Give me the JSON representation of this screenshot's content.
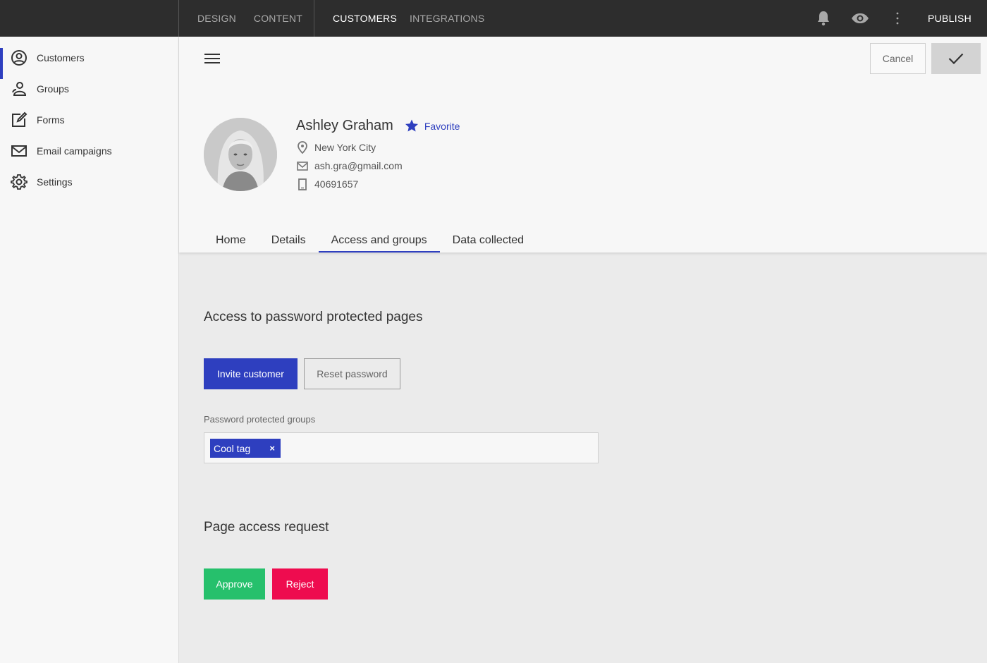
{
  "topbar": {
    "nav_left": [
      "DESIGN",
      "CONTENT"
    ],
    "nav_right": [
      "CUSTOMERS",
      "INTEGRATIONS"
    ],
    "active": "CUSTOMERS",
    "publish_label": "PUBLISH",
    "icons": [
      "bell-icon",
      "eye-icon",
      "more-vertical-icon"
    ]
  },
  "sidebar": {
    "items": [
      {
        "label": "Customers",
        "icon": "user-circle-icon",
        "active": true
      },
      {
        "label": "Groups",
        "icon": "group-icon",
        "active": false
      },
      {
        "label": "Forms",
        "icon": "edit-form-icon",
        "active": false
      },
      {
        "label": "Email campaigns",
        "icon": "mail-icon",
        "active": false
      },
      {
        "label": "Settings",
        "icon": "gear-icon",
        "active": false
      }
    ]
  },
  "header": {
    "cancel_label": "Cancel",
    "confirm_icon": "check-icon",
    "customer": {
      "name": "Ashley Graham",
      "favorite_label": "Favorite",
      "location": "New York City",
      "email": "ash.gra@gmail.com",
      "phone": "40691657"
    },
    "tabs": [
      "Home",
      "Details",
      "Access and groups",
      "Data collected"
    ],
    "active_tab": "Access and groups"
  },
  "main": {
    "access_title": "Access to password protected pages",
    "invite_label": "Invite customer",
    "reset_label": "Reset password",
    "groups_label": "Password protected groups",
    "tags": [
      "Cool tag"
    ],
    "tag_remove": "×",
    "request_title": "Page access request",
    "approve_label": "Approve",
    "reject_label": "Reject"
  },
  "colors": {
    "accent": "#2e3fbf",
    "approve": "#26c06c",
    "reject": "#ee0c4f",
    "topbar": "#2d2d2d"
  }
}
